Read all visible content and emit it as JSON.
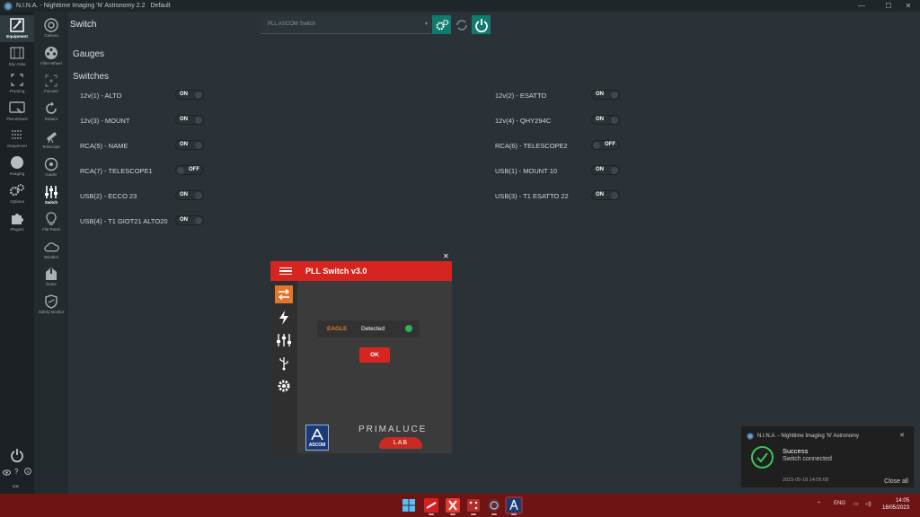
{
  "window": {
    "title": "N.I.N.A. - Nighttime Imaging 'N' Astronomy 2.2",
    "profile": "Default",
    "minimize": "—",
    "maximize": "☐",
    "close": "✕"
  },
  "sidebar": {
    "items": [
      {
        "label": "Equipment",
        "icon": "telescope-icon"
      },
      {
        "label": "Sky Atlas",
        "icon": "map-icon"
      },
      {
        "label": "Framing",
        "icon": "frame-icon"
      },
      {
        "label": "Flat Wizard",
        "icon": "wand-icon"
      },
      {
        "label": "Sequencer",
        "icon": "list-icon"
      },
      {
        "label": "Imaging",
        "icon": "circle-icon"
      },
      {
        "label": "Options",
        "icon": "gears-icon"
      },
      {
        "label": "Plugins",
        "icon": "puzzle-icon"
      }
    ],
    "collapse": "<<"
  },
  "subbar": {
    "items": [
      {
        "label": "Camera"
      },
      {
        "label": "Filter Wheel"
      },
      {
        "label": "Focuser"
      },
      {
        "label": "Rotator"
      },
      {
        "label": "Telescope"
      },
      {
        "label": "Guider"
      },
      {
        "label": "Switch"
      },
      {
        "label": "Flat Panel"
      },
      {
        "label": "Weather"
      },
      {
        "label": "Dome"
      },
      {
        "label": "Safety Monitor"
      }
    ]
  },
  "main": {
    "title": "Switch",
    "device_select": "PLL ASCOM Switch",
    "gauges_heading": "Gauges",
    "switches_heading": "Switches",
    "switches": [
      {
        "label": "12v(1) - ALTO",
        "state": "ON"
      },
      {
        "label": "12v(2) - ESATTO",
        "state": "ON"
      },
      {
        "label": "12v(3) - MOUNT",
        "state": "ON"
      },
      {
        "label": "12v(4) - QHY294C",
        "state": "ON"
      },
      {
        "label": "RCA(5) - NAME",
        "state": "ON"
      },
      {
        "label": "RCA(6) - TELESCOPE2",
        "state": "OFF"
      },
      {
        "label": "RCA(7) - TELESCOPE1",
        "state": "OFF"
      },
      {
        "label": "USB(1) - MOUNT 10",
        "state": "ON"
      },
      {
        "label": "USB(2) - ECCO 23",
        "state": "ON"
      },
      {
        "label": "USB(3) - T1 ESATTO 22",
        "state": "ON"
      },
      {
        "label": "USB(4) - T1 GIOT21 ALTO20",
        "state": "ON"
      }
    ]
  },
  "dialog": {
    "title": "PLL Switch v3.0",
    "close": "✕",
    "device": "EAGLE",
    "status": "Detected",
    "ok": "OK",
    "ascom": "ASCOM",
    "brand": "PRIMALUCE",
    "brand_lab": "LAB",
    "colors": {
      "header": "#d6251f",
      "accent": "#e2772a",
      "status_dot": "#2fae5c"
    }
  },
  "toast": {
    "app": "N.I.N.A. - Nighttime Imaging 'N' Astronomy",
    "heading": "Success",
    "message": "Switch connected",
    "timestamp": "2023-05-18 14:05:08",
    "close_all": "Close all"
  },
  "taskbar": {
    "lang": "ENG",
    "time": "14:05",
    "date": "18/05/2023"
  }
}
